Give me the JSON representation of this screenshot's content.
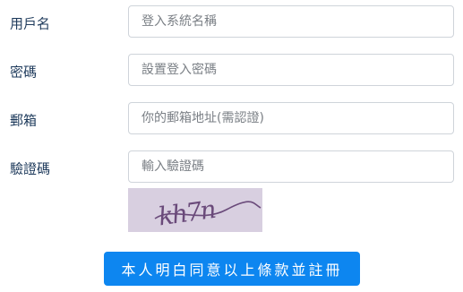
{
  "form": {
    "username": {
      "label": "用戶名",
      "placeholder": "登入系統名稱",
      "value": ""
    },
    "password": {
      "label": "密碼",
      "placeholder": "設置登入密碼",
      "value": ""
    },
    "email": {
      "label": "郵箱",
      "placeholder": "你的郵箱地址(需認證)",
      "value": ""
    },
    "captcha": {
      "label": "驗證碼",
      "placeholder": "輸入驗證碼",
      "value": "",
      "image_text": "kh7n"
    },
    "submit_label": "本人明白同意以上條款並註冊"
  },
  "colors": {
    "label_text": "#1f3b5c",
    "button_bg": "#0d86f0",
    "button_text": "#ffffff",
    "input_border": "#cfd4da",
    "captcha_bg": "#d8cfe0",
    "captcha_ink": "#6a4a7a"
  }
}
